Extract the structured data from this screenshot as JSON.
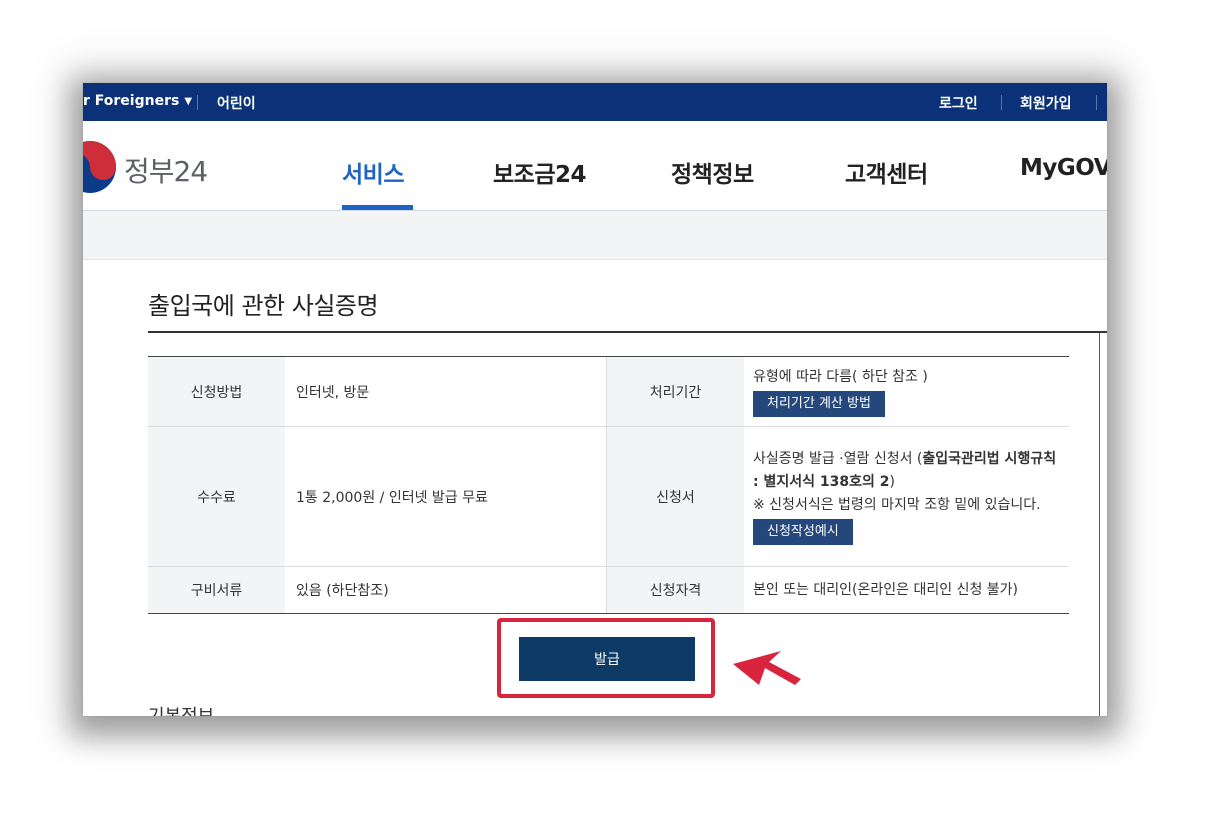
{
  "topbar": {
    "foreigners": "r Foreigners",
    "kids": "어린이",
    "login": "로그인",
    "signup": "회원가입"
  },
  "header": {
    "logo_text": "정부24",
    "nav": [
      {
        "label": "서비스",
        "active": true
      },
      {
        "label": "보조금24",
        "active": false
      },
      {
        "label": "정책정보",
        "active": false
      },
      {
        "label": "고객센터",
        "active": false
      },
      {
        "label": "MyGOV",
        "active": false
      }
    ]
  },
  "page": {
    "title": "출입국에 관한 사실증명"
  },
  "table": {
    "method_label": "신청방법",
    "method_value": "인터넷, 방문",
    "period_label": "처리기간",
    "period_value": "유형에 따라 다름( 하단 참조 )",
    "period_button": "처리기간 계산 방법",
    "fee_label": "수수료",
    "fee_value": "1통 2,000원 / 인터넷 발급 무료",
    "form_label": "신청서",
    "form_text_1": "사실증명 발급 ·열람 신청서 (",
    "form_text_bold": "출입국관리법 시행규칙 : 별지서식 138호의 2",
    "form_text_2": ")",
    "form_note": "※ 신청서식은 법령의 마지막 조항 밑에 있습니다.",
    "form_button": "신청작성예시",
    "docs_label": "구비서류",
    "docs_value": "있음 (하단참조)",
    "qual_label": "신청자격",
    "qual_value": "본인 또는 대리인(온라인은 대리인 신청 불가)"
  },
  "actions": {
    "issue_label": "발급"
  },
  "section_cutoff": "기본정보",
  "colors": {
    "topbar_bg": "#0b3278",
    "nav_active": "#1e63c6",
    "highlight_box": "#d8243d",
    "issue_button": "#0e3a66",
    "small_button": "#24477c"
  }
}
